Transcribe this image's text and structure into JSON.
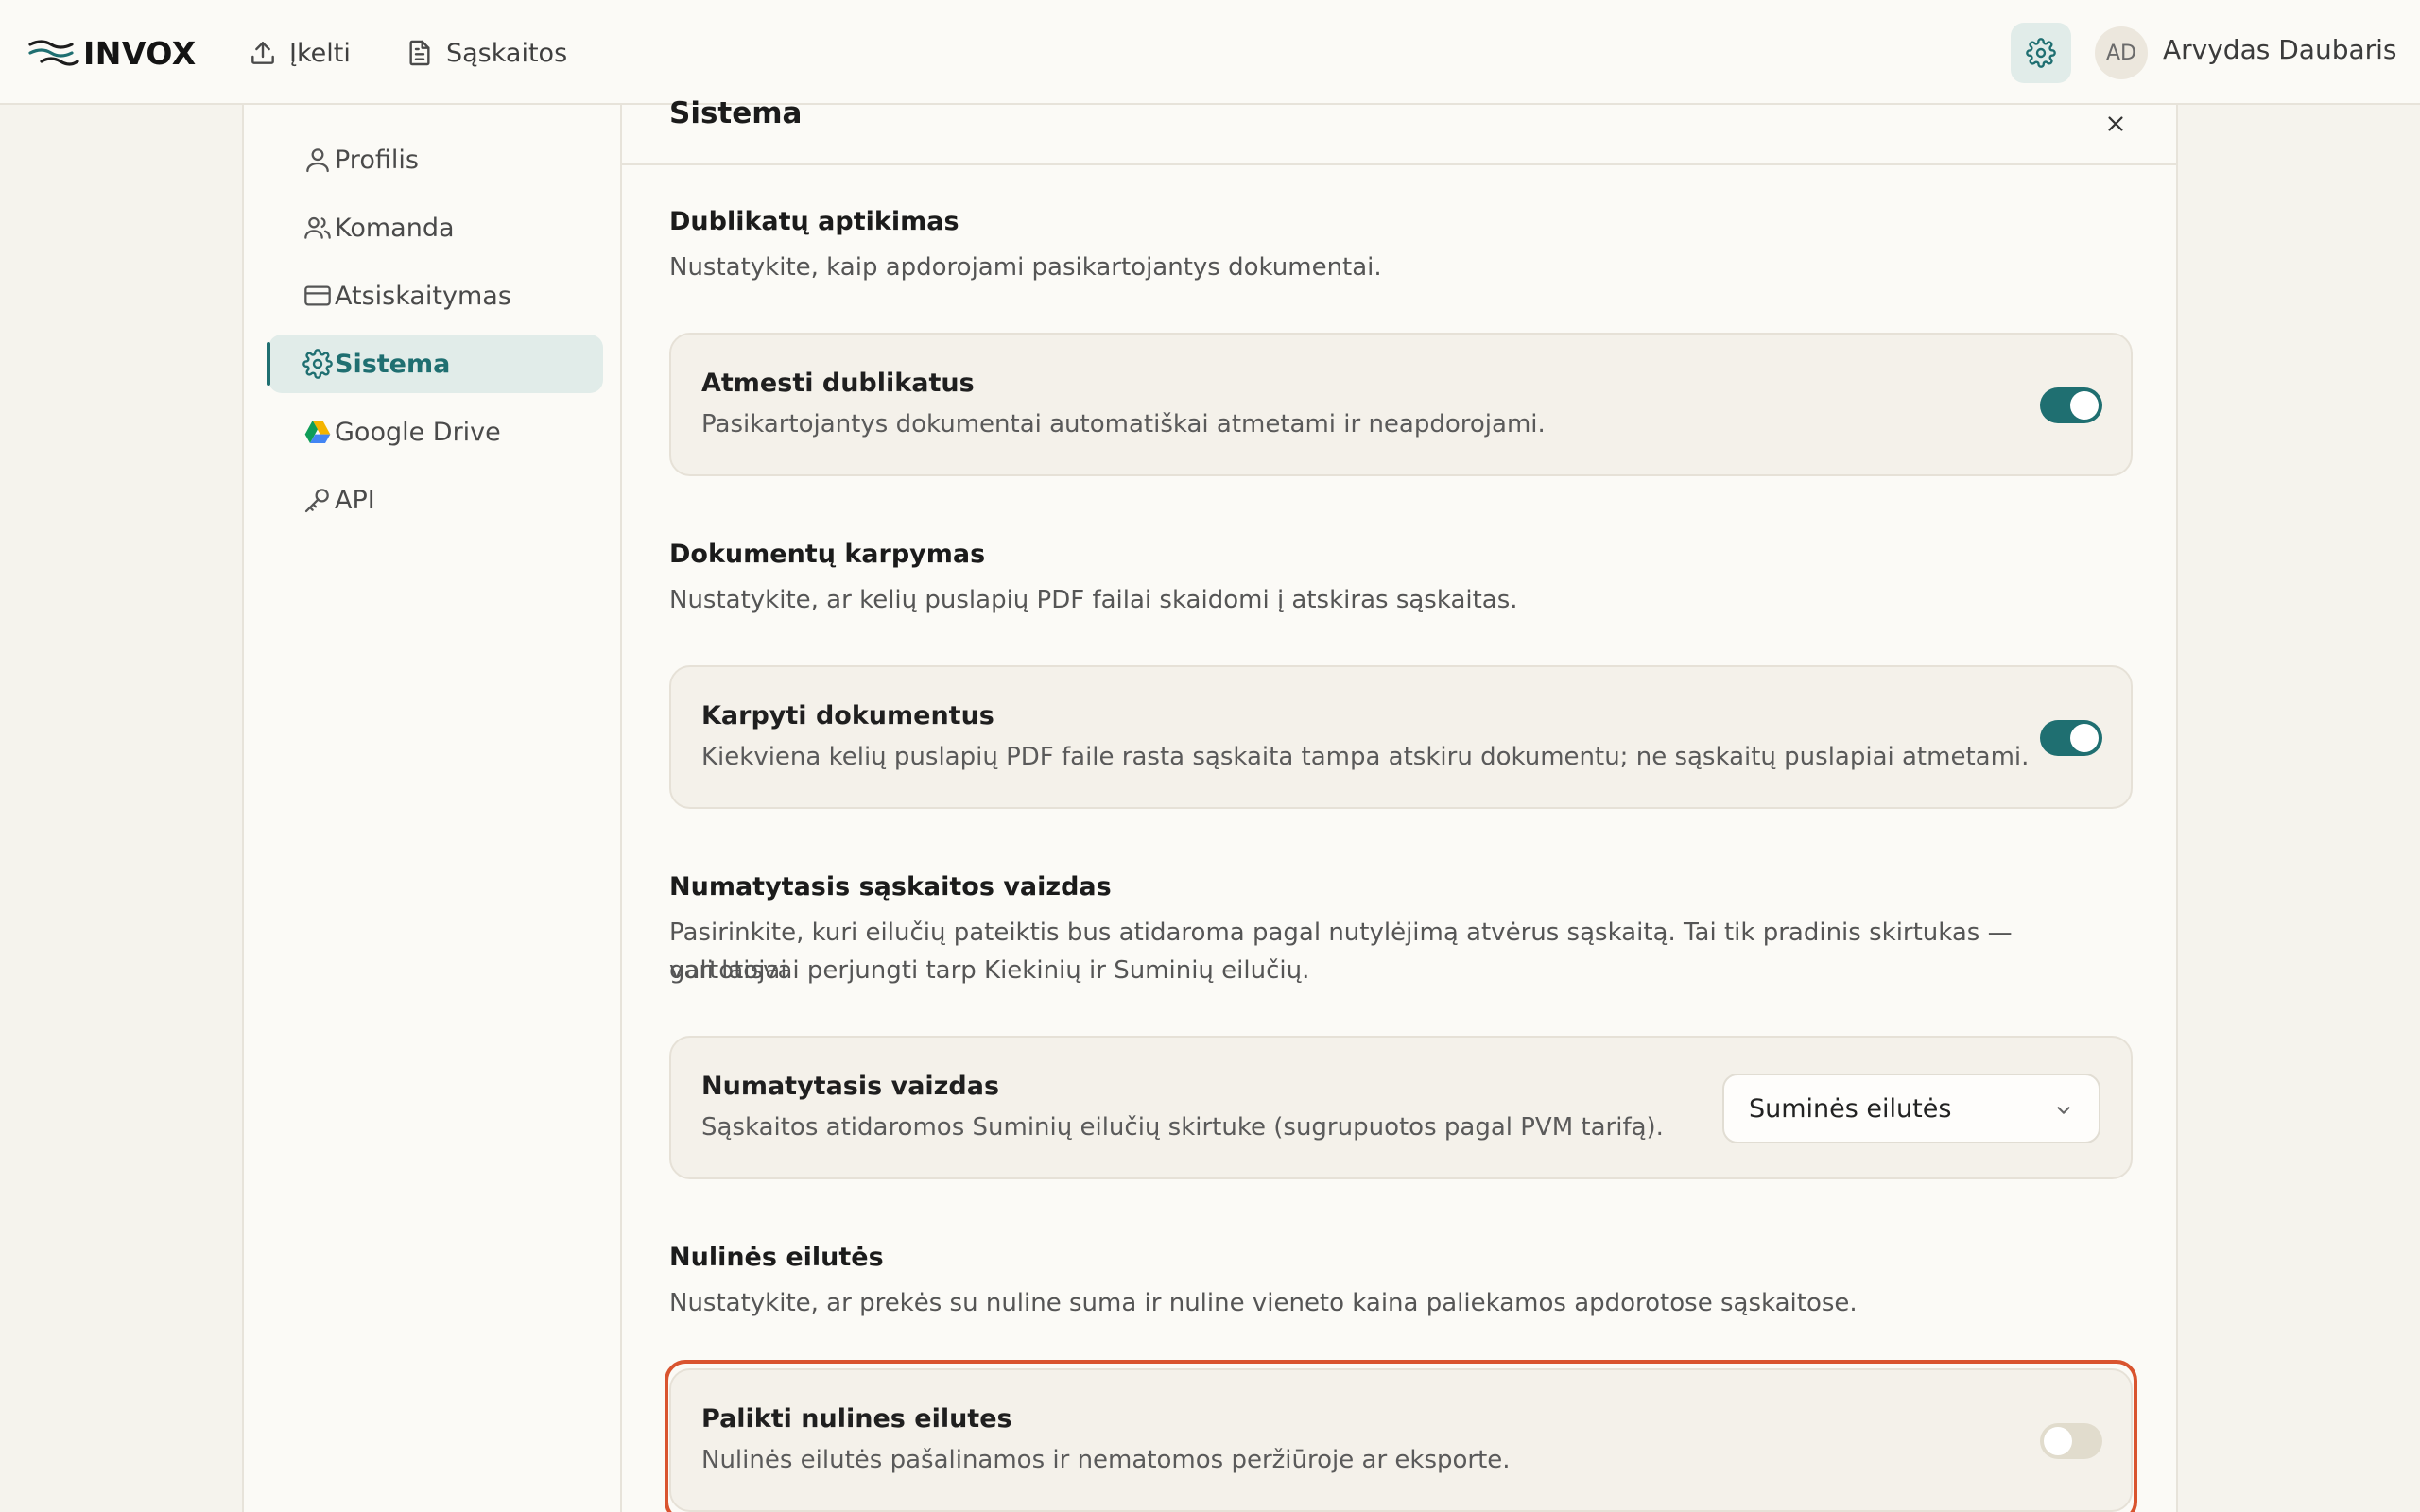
{
  "app": {
    "logo_text": "INVOX",
    "nav": {
      "upload_label": "Įkelti",
      "invoices_label": "Sąskaitos"
    },
    "user": {
      "initials": "AD",
      "name": "Arvydas Daubaris"
    }
  },
  "sidebar": {
    "items": [
      {
        "label": "Profilis",
        "icon": "user-icon"
      },
      {
        "label": "Komanda",
        "icon": "team-icon"
      },
      {
        "label": "Atsiskaitymas",
        "icon": "credit-card-icon"
      },
      {
        "label": "Sistema",
        "icon": "gear-icon",
        "active": true
      },
      {
        "label": "Google Drive",
        "icon": "google-drive-icon"
      },
      {
        "label": "API",
        "icon": "key-icon"
      }
    ]
  },
  "panel": {
    "title": "Sistema",
    "sections": [
      {
        "title": "Dublikatų aptikimas",
        "description": "Nustatykite, kaip apdorojami pasikartojantys dokumentai.",
        "card": {
          "title": "Atmesti dublikatus",
          "description": "Pasikartojantys dokumentai automatiškai atmetami ir neapdorojami.",
          "toggle_on": true
        }
      },
      {
        "title": "Dokumentų karpymas",
        "description": "Nustatykite, ar kelių puslapių PDF failai skaidomi į atskiras sąskaitas.",
        "card": {
          "title": "Karpyti dokumentus",
          "description": "Kiekviena kelių puslapių PDF faile rasta sąskaita tampa atskiru dokumentu; ne sąskaitų puslapiai atmetami.",
          "toggle_on": true
        }
      },
      {
        "title": "Numatytasis sąskaitos vaizdas",
        "description_line1": "Pasirinkite, kuri eilučių pateiktis bus atidaroma pagal nutylėjimą atvėrus sąskaitą. Tai tik pradinis skirtukas — vartotojai",
        "description_line2": "gali laisvai perjungti tarp Kiekinių ir Suminių eilučių.",
        "card": {
          "title": "Numatytasis vaizdas",
          "description": "Sąskaitos atidaromos Suminių eilučių skirtuke (sugrupuotos pagal PVM tarifą).",
          "select_value": "Suminės eilutės"
        }
      },
      {
        "title": "Nulinės eilutės",
        "description": "Nustatykite, ar prekės su nuline suma ir nuline vieneto kaina paliekamos apdorotose sąskaitose.",
        "card": {
          "title": "Palikti nulines eilutes",
          "description": "Nulinės eilutės pašalinamos ir nematomos peržiūroje ar eksporte.",
          "toggle_on": false
        }
      }
    ]
  },
  "colors": {
    "accent": "#1f6f71",
    "highlight": "#d9542f",
    "background": "#f5f3ed"
  }
}
